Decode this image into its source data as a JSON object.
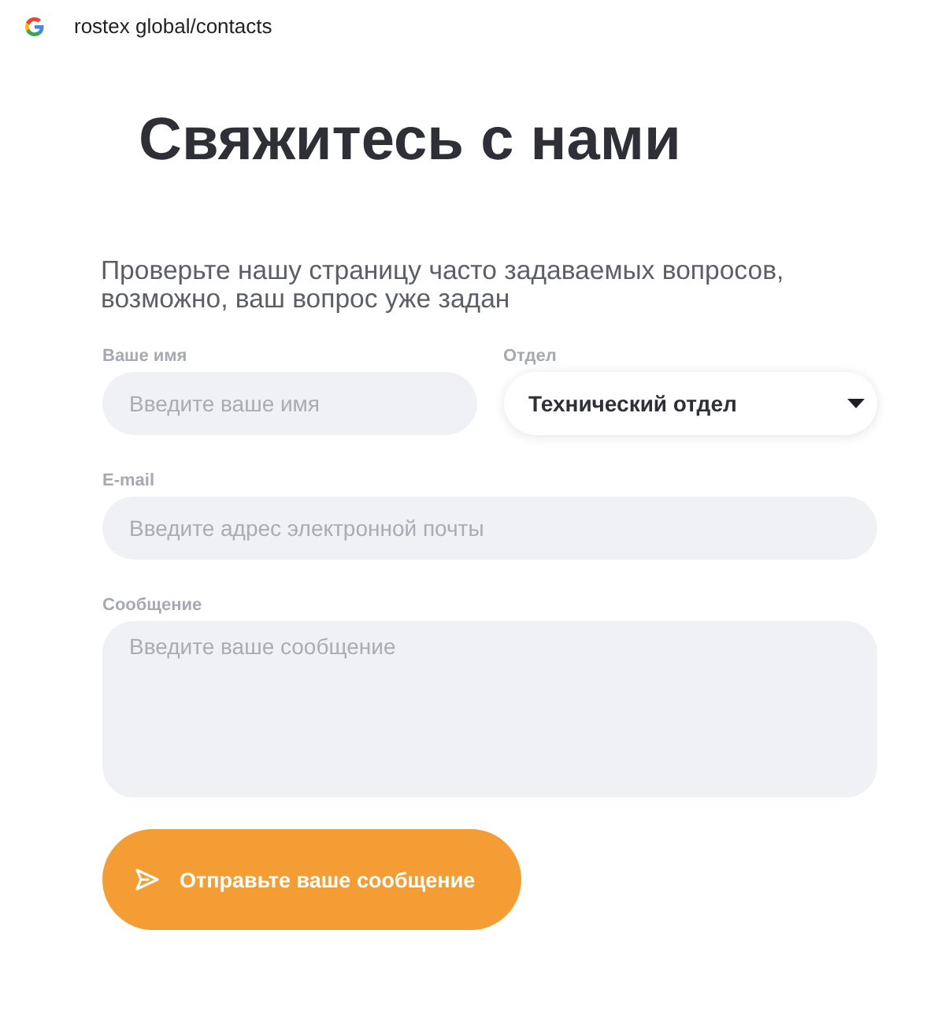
{
  "browser_bar": {
    "url": "rostex global/contacts"
  },
  "heading": "Свяжитесь с нами",
  "intro": "Проверьте нашу страницу часто задаваемых вопросов, возможно, ваш вопрос уже задан",
  "form": {
    "rows": [
      [
        {
          "kind": "input",
          "label": "Ваше имя",
          "placeholder": "Введите ваше имя"
        },
        {
          "kind": "select",
          "label": "Отдел",
          "value": "Технический отдел"
        }
      ],
      [
        {
          "kind": "input",
          "label": "E-mail",
          "placeholder": "Введите адрес электронной почты"
        }
      ],
      [
        {
          "kind": "textarea",
          "label": "Сообщение",
          "placeholder": "Введите ваше сообщение"
        }
      ]
    ],
    "submit": "Отправьте ваше сообщение"
  }
}
